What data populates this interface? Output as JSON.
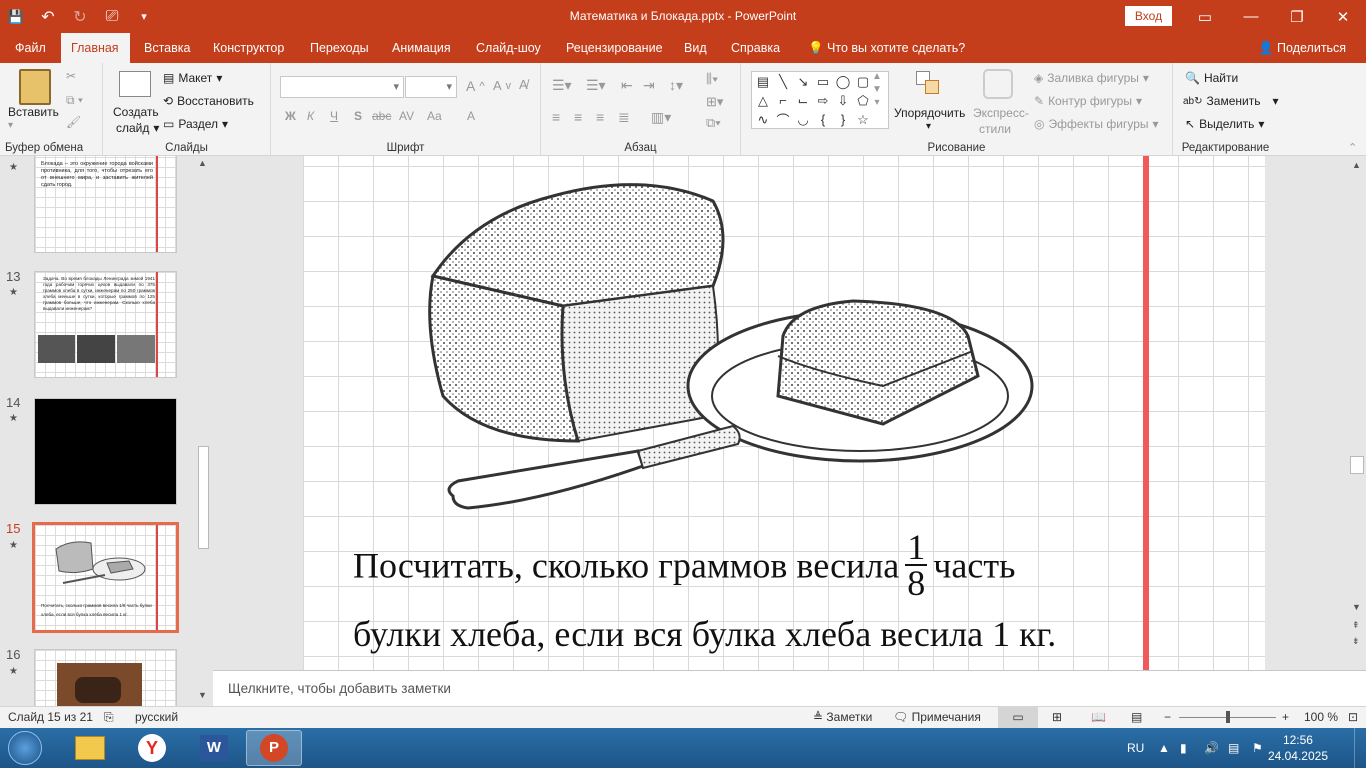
{
  "window": {
    "title": "Математика и Блокада.pptx  -  PowerPoint",
    "signin": "Вход",
    "minimize": "—",
    "restore": "❐",
    "close": "✕",
    "ribbon_display": "▭"
  },
  "qat": {
    "save": "💾",
    "undo": "↶",
    "redo": "↻",
    "present": "⎚",
    "customize": "▾"
  },
  "menu": {
    "tabs": [
      "Файл",
      "Главная",
      "Вставка",
      "Конструктор",
      "Переходы",
      "Анимация",
      "Слайд-шоу",
      "Рецензирование",
      "Вид",
      "Справка"
    ],
    "tell_me": "Что вы хотите сделать?",
    "share": "Поделиться"
  },
  "ribbon": {
    "clipboard": {
      "paste": "Вставить",
      "label": "Буфер обмена"
    },
    "slides": {
      "new_slide": "Создать",
      "new_slide2": "слайд",
      "layout": "Макет",
      "reset": "Восстановить",
      "section": "Раздел",
      "label": "Слайды"
    },
    "font": {
      "bold": "Ж",
      "italic": "К",
      "underline": "Ч",
      "shadow": "S",
      "strike": "abc",
      "spacing": "AV",
      "case": "Aa",
      "color": "A",
      "label": "Шрифт"
    },
    "paragraph": {
      "label": "Абзац"
    },
    "drawing": {
      "arrange": "Упорядочить",
      "quick_styles": "Экспресс-",
      "quick_styles2": "стили",
      "fill": "Заливка фигуры",
      "outline": "Контур фигуры",
      "effects": "Эффекты фигуры",
      "label": "Рисование"
    },
    "editing": {
      "find": "Найти",
      "replace": "Заменить",
      "select": "Выделить",
      "label": "Редактирование"
    }
  },
  "thumbnails": [
    {
      "num": "",
      "text": "Блокада – это окружение города войсками противника, для того, чтобы отрезать его от внешнего мира, и заставить жителей сдать город."
    },
    {
      "num": "13",
      "text": "Задача. Во время блокады Ленинграда зимой 1941 года рабочим горячих цехов выдавали по 375 граммов хлеба в сутки, инженерам по 250 граммов хлеба меньше в сутки, которые граммов по 125 граммов больше, что инженерам. Сколько хлеба выдавали инженерам?"
    },
    {
      "num": "14",
      "text": ""
    },
    {
      "num": "15",
      "text": "Посчитать, сколько граммов весила 1/8 часть булки хлеба, если вся булка хлеба весила 1 кг."
    },
    {
      "num": "16",
      "text": ""
    }
  ],
  "slide": {
    "line1_before": "Посчитать,  сколько граммов весила",
    "frac_num": "1",
    "frac_den": "8",
    "line1_after": "часть",
    "line2": "булки хлеба, если вся булка хлеба весила 1 кг."
  },
  "notes": {
    "placeholder": "Щелкните, чтобы добавить заметки"
  },
  "status": {
    "slide_info": "Слайд 15 из 21",
    "language": "русский",
    "notes": "Заметки",
    "comments": "Примечания",
    "zoom": "100 %"
  },
  "taskbar": {
    "lang": "RU",
    "time": "12:56",
    "date": "24.04.2025"
  },
  "colors": {
    "accent": "#c43e1c",
    "slide_red_line": "#ef5b5b"
  }
}
